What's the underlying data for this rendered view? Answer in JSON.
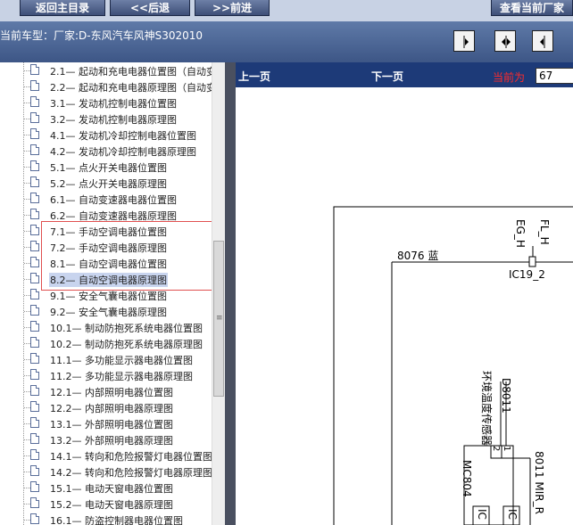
{
  "toolbar": {
    "back_main": "返回主目录",
    "back": "<<后退",
    "forward": ">>前进",
    "view_current": "查看当前厂家"
  },
  "header": {
    "model_text": "当前车型：厂家:D-东风汽车风神S302010"
  },
  "tree": {
    "items": [
      "2.1— 起动和充电电器位置图（自动变",
      "2.2— 起动和充电电器原理图（自动变",
      "3.1— 发动机控制电器位置图",
      "3.2— 发动机控制电器原理图",
      "4.1— 发动机冷却控制电器位置图",
      "4.2— 发动机冷却控制电器原理图",
      "5.1— 点火开关电器位置图",
      "5.2— 点火开关电器原理图",
      "6.1— 自动变速器电器位置图",
      "6.2— 自动变速器电器原理图",
      "7.1— 手动空调电器位置图",
      "7.2— 手动空调电器原理图",
      "8.1— 自动空调电器位置图",
      "8.2— 自动空调电器原理图",
      "9.1— 安全气囊电器位置图",
      "9.2— 安全气囊电器原理图",
      "10.1— 制动防抱死系统电器位置图",
      "10.2— 制动防抱死系统电器原理图",
      "11.1— 多功能显示器电器位置图",
      "11.2— 多功能显示器电器原理图",
      "12.1— 内部照明电器位置图",
      "12.2— 内部照明电器原理图",
      "13.1— 外部照明电器位置图",
      "13.2— 外部照明电器原理图",
      "14.1— 转向和危险报警灯电器位置图",
      "14.2— 转向和危险报警灯电器原理图",
      "15.1— 电动天窗电器位置图",
      "15.2— 电动天窗电器原理图",
      "16.1— 防盗控制器电器位置图"
    ],
    "selected_index": 13
  },
  "nav": {
    "prev": "上一页",
    "next": "下一页",
    "current_label": "当前为",
    "current_value": "67"
  },
  "diagram": {
    "label_fl_h": "FL_H",
    "label_eg_h": "EG_H",
    "label_wire": "8076 蓝",
    "label_ic19": "IC19_2",
    "label_d8011": "D8011",
    "label_sensor": "环境温度传感器",
    "label_mc804": "MC804",
    "label_8011": "8011 MIR_R",
    "label_pin1": "1",
    "label_pin2": "2",
    "label_ic_a": "IC",
    "label_ic_b": "IC"
  },
  "colors": {
    "header_bg": "#4a6598",
    "nav_bg": "#1d3a78",
    "current_label": "#ff2b2b",
    "highlight_box": "#e05050"
  }
}
